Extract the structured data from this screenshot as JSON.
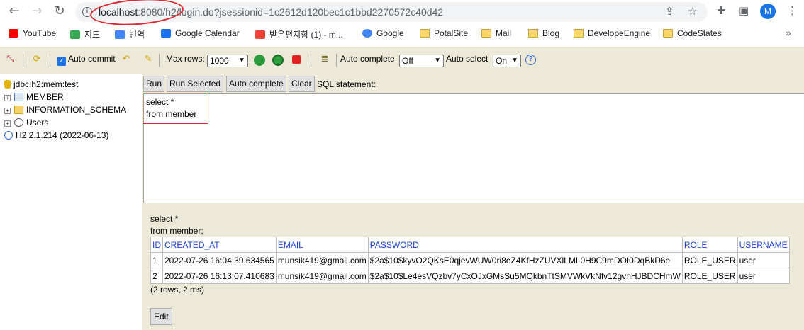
{
  "browser": {
    "url_host": "localhost",
    "url_rest": ":8080/h2/login.do?jsessionid=1c2612d120bec1c1bbd2270572c40d42",
    "avatar_letter": "M",
    "bookmarks": [
      {
        "label": "YouTube",
        "icon": "youtube-icon"
      },
      {
        "label": "지도",
        "icon": "maps-icon"
      },
      {
        "label": "번역",
        "icon": "translate-icon"
      },
      {
        "label": "Google Calendar",
        "icon": "calendar-icon"
      },
      {
        "label": "받은편지함 (1) - m...",
        "icon": "gmail-icon"
      },
      {
        "label": "Google",
        "icon": "google-icon"
      },
      {
        "label": "PotalSite",
        "icon": "folder-icon"
      },
      {
        "label": "Mail",
        "icon": "folder-icon"
      },
      {
        "label": "Blog",
        "icon": "folder-icon"
      },
      {
        "label": "DevelopeEngine",
        "icon": "folder-icon"
      },
      {
        "label": "CodeStates",
        "icon": "folder-icon"
      }
    ],
    "more_label": "»"
  },
  "toolbar": {
    "auto_commit": "Auto commit",
    "max_rows_label": "Max rows:",
    "max_rows_value": "1000",
    "auto_complete_label": "Auto complete",
    "auto_complete_value": "Off",
    "auto_select_label": "Auto select",
    "auto_select_value": "On",
    "help": "?"
  },
  "tree": {
    "connection": "jdbc:h2:mem:test",
    "items": [
      "MEMBER",
      "INFORMATION_SCHEMA",
      "Users"
    ],
    "version": "H2 2.1.214 (2022-06-13)"
  },
  "query": {
    "buttons": {
      "run": "Run",
      "run_selected": "Run Selected",
      "auto_complete": "Auto complete",
      "clear": "Clear"
    },
    "label": "SQL statement:",
    "text": "select *\nfrom member"
  },
  "results": {
    "statement_line1": "select *",
    "statement_line2": "from member;",
    "columns": [
      "ID",
      "CREATED_AT",
      "EMAIL",
      "PASSWORD",
      "ROLE",
      "USERNAME"
    ],
    "rows": [
      [
        "1",
        "2022-07-26 16:04:39.634565",
        "munsik419@gmail.com",
        "$2a$10$kyvO2QKsE0qjevWUW0ri8eZ4KfHzZUVXlLML0H9C9mDOI0DqBkD6e",
        "ROLE_USER",
        "user"
      ],
      [
        "2",
        "2022-07-26 16:13:07.410683",
        "munsik419@gmail.com",
        "$2a$10$Le4esVQzbv7yCxOJxGMsSu5MQkbnTtSMVWkVkNfv12gvnHJBDCHmW",
        "ROLE_USER",
        "user"
      ]
    ],
    "summary": "(2 rows, 2 ms)",
    "edit_label": "Edit"
  },
  "colors": {
    "accent": "#1a73e8",
    "highlight_red": "#e0272f",
    "h2_background": "#ece9d8",
    "header_link": "#1c3fd1"
  }
}
